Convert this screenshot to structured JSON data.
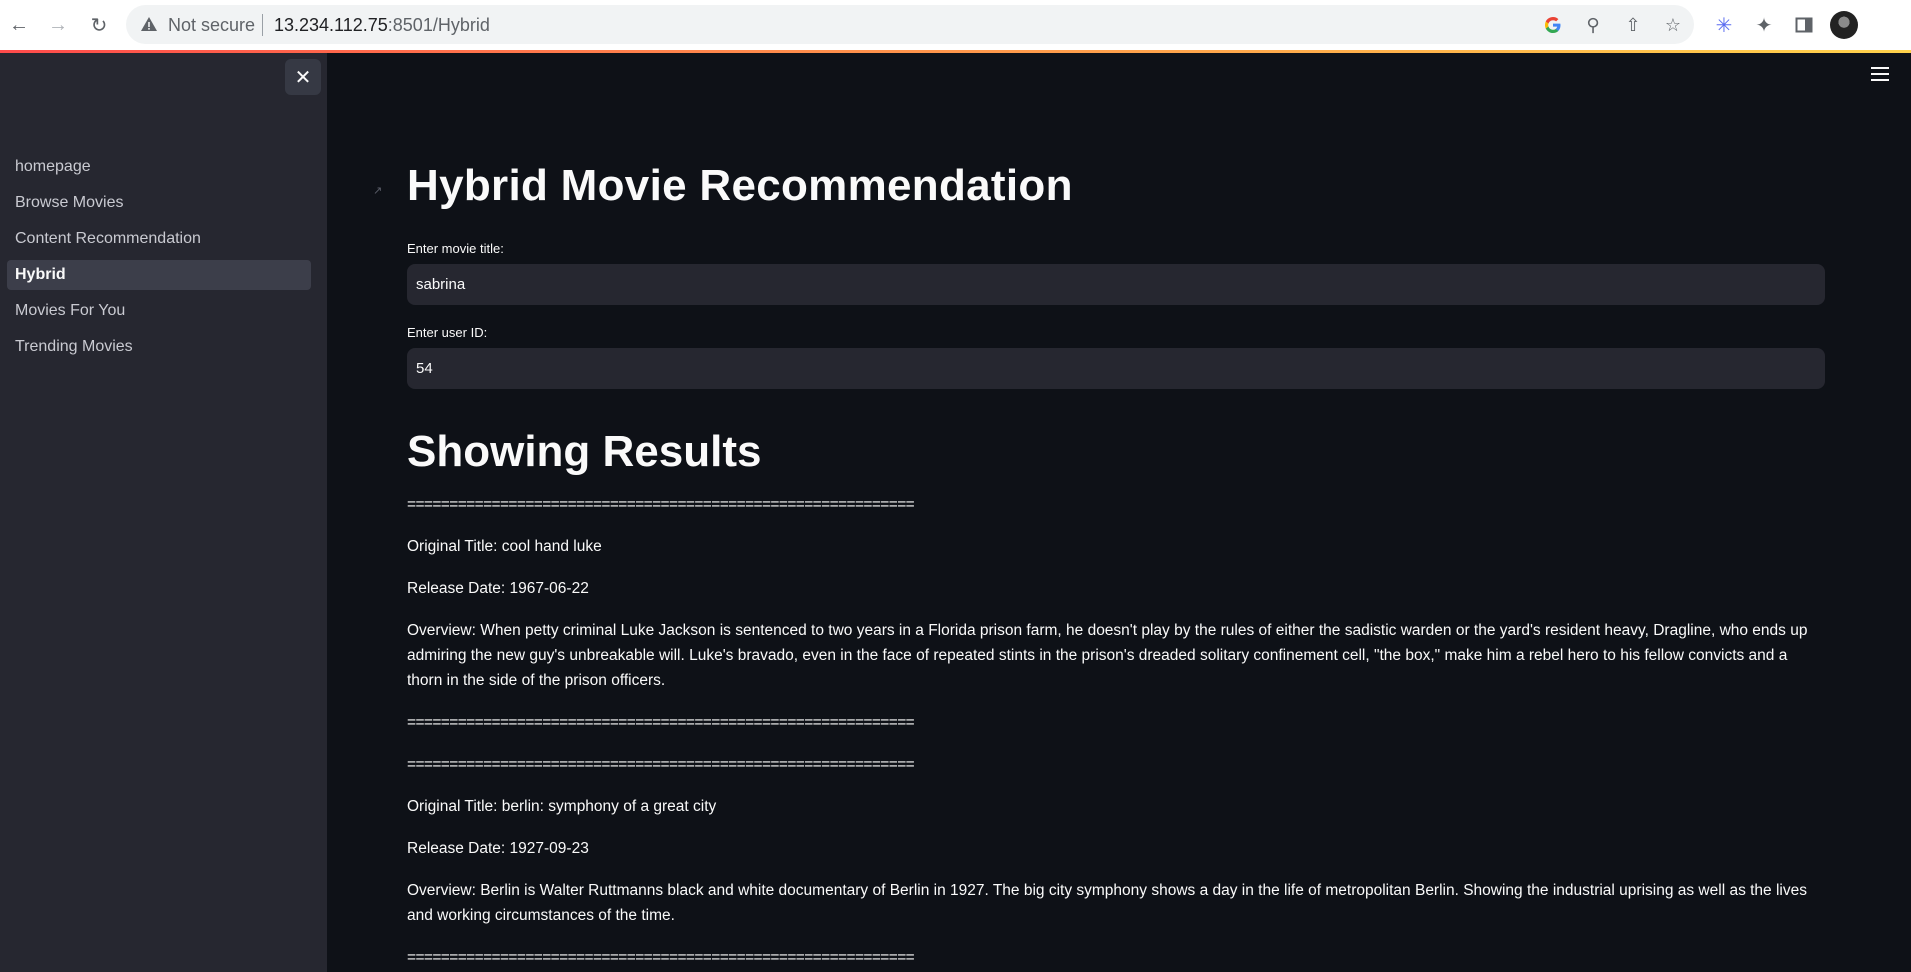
{
  "browser": {
    "security_label": "Not secure",
    "url_host": "13.234.112.75",
    "url_path": ":8501/Hybrid"
  },
  "sidebar": {
    "items": [
      {
        "label": "homepage",
        "active": false
      },
      {
        "label": "Browse Movies",
        "active": false
      },
      {
        "label": "Content Recommendation",
        "active": false
      },
      {
        "label": "Hybrid",
        "active": true
      },
      {
        "label": "Movies For You",
        "active": false
      },
      {
        "label": "Trending Movies",
        "active": false
      }
    ]
  },
  "main": {
    "title": "Hybrid Movie Recommendation",
    "movie_field": {
      "label": "Enter movie title:",
      "value": "sabrina"
    },
    "user_field": {
      "label": "Enter user ID:",
      "value": "54"
    },
    "results_heading": "Showing Results",
    "separator": "============================================================",
    "results": [
      {
        "title": "Original Title: cool hand luke",
        "release": "Release Date: 1967-06-22",
        "overview": "Overview: When petty criminal Luke Jackson is sentenced to two years in a Florida prison farm, he doesn't play by the rules of either the sadistic warden or the yard's resident heavy, Dragline, who ends up admiring the new guy's unbreakable will. Luke's bravado, even in the face of repeated stints in the prison's dreaded solitary confinement cell, \"the box,\" make him a rebel hero to his fellow convicts and a thorn in the side of the prison officers."
      },
      {
        "title": "Original Title: berlin: symphony of a great city",
        "release": "Release Date: 1927-09-23",
        "overview": "Overview: Berlin is Walter Ruttmanns black and white documentary of Berlin in 1927. The big city symphony shows a day in the life of metropolitan Berlin. Showing the industrial uprising as well as the lives and working circumstances of the time."
      }
    ]
  }
}
